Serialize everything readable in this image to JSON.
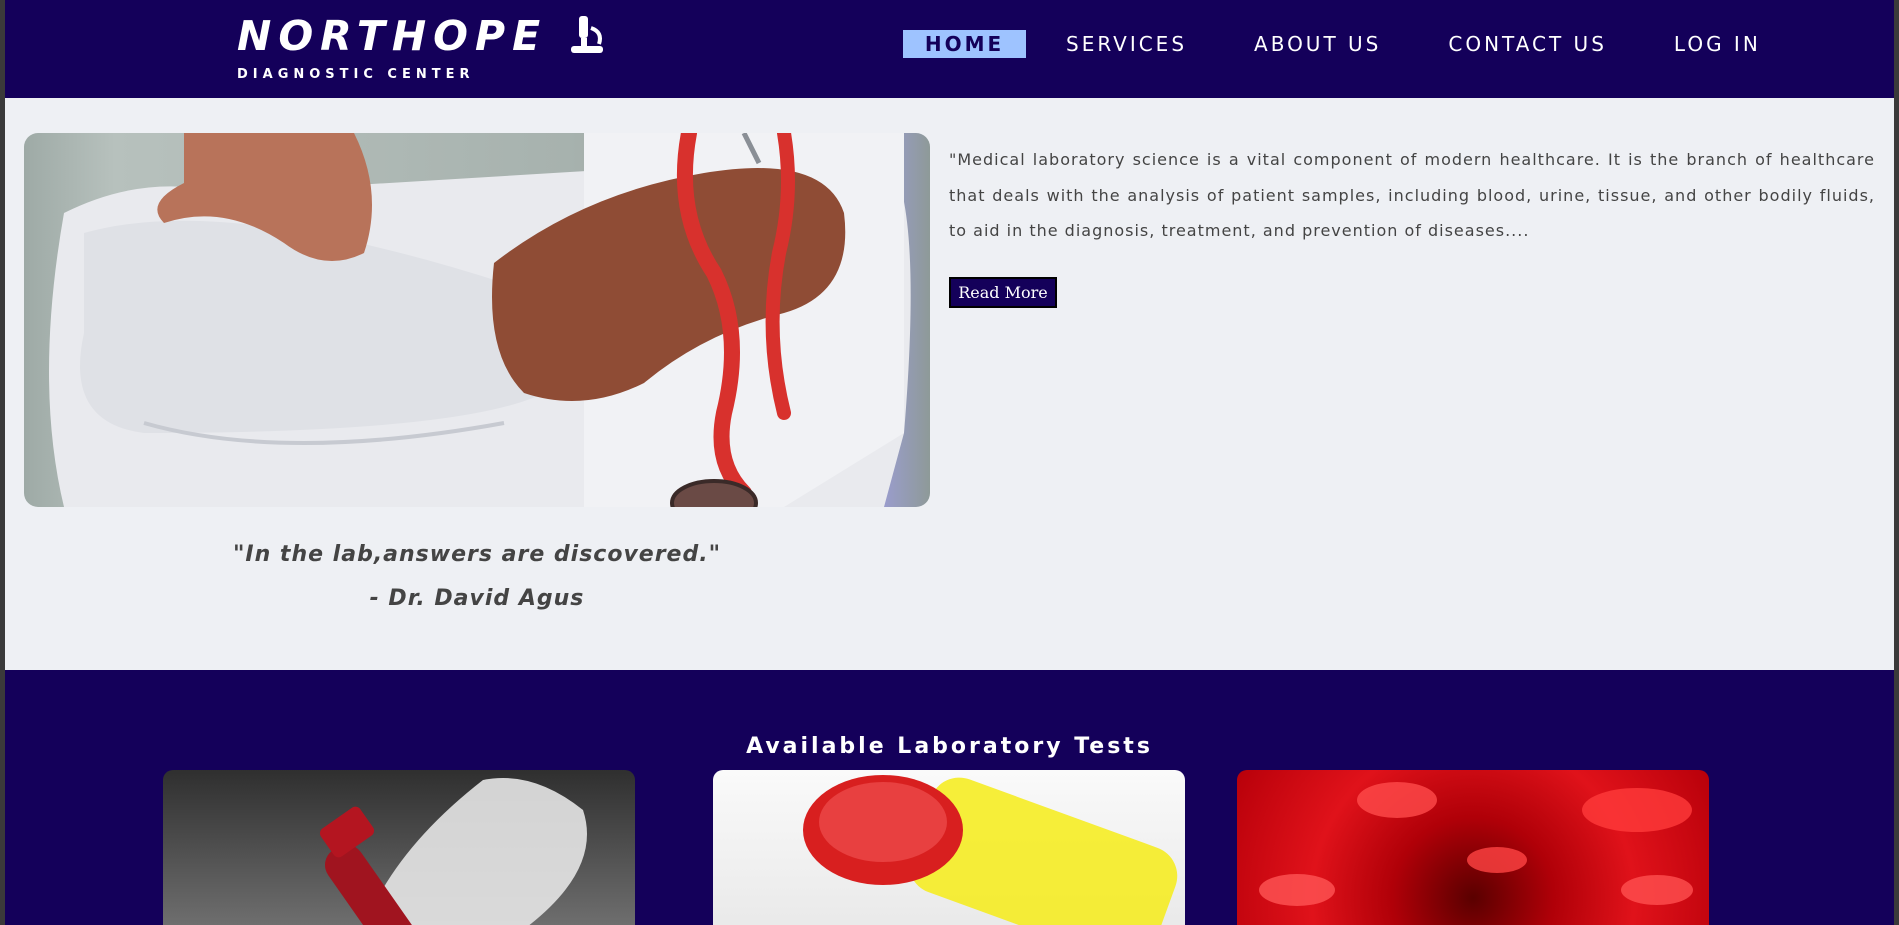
{
  "brand": {
    "name": "NORTHOPE",
    "subtitle": "DIAGNOSTIC CENTER",
    "icon": "microscope-icon"
  },
  "nav": {
    "items": [
      {
        "label": "HOME",
        "active": true
      },
      {
        "label": "SERVICES",
        "active": false
      },
      {
        "label": "ABOUT US",
        "active": false
      },
      {
        "label": "CONTACT US",
        "active": false
      },
      {
        "label": "LOG IN",
        "active": false
      }
    ]
  },
  "hero": {
    "image": "doctor-with-stethoscope-image",
    "intro": "\"Medical laboratory science is a vital component of modern healthcare. It is the branch of healthcare that deals with the analysis of patient samples, including blood, urine, tissue, and other bodily fluids, to aid in the diagnosis, treatment, and prevention of diseases....",
    "read_more_label": "Read More",
    "quote": "\"In the lab,answers are discovered.\"",
    "quote_author": "- Dr. David Agus"
  },
  "tests": {
    "title": "Available Laboratory Tests",
    "cards": [
      {
        "image": "blood-test-tube-image"
      },
      {
        "image": "urine-sample-cup-image"
      },
      {
        "image": "red-blood-cells-image"
      }
    ]
  },
  "colors": {
    "primary": "#14005a",
    "active_nav": "#9ec3ff",
    "background": "#eef0f4",
    "text": "#444444"
  }
}
